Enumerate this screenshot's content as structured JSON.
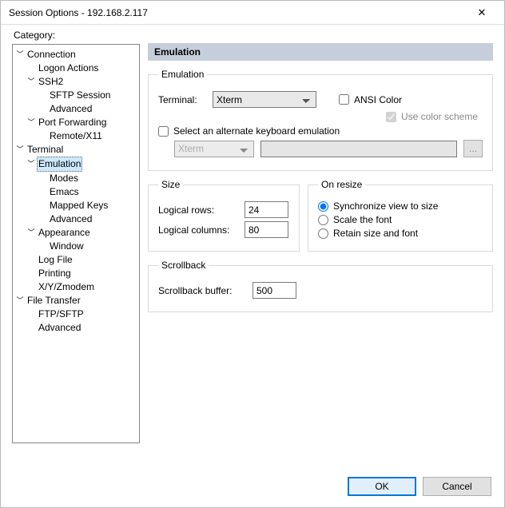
{
  "window": {
    "title": "Session Options - 192.168.2.117"
  },
  "category_label": "Category:",
  "tree": {
    "connection": "Connection",
    "logon_actions": "Logon Actions",
    "ssh2": "SSH2",
    "sftp_session": "SFTP Session",
    "ssh2_advanced": "Advanced",
    "port_forwarding": "Port Forwarding",
    "remote_x11": "Remote/X11",
    "terminal": "Terminal",
    "emulation": "Emulation",
    "modes": "Modes",
    "emacs": "Emacs",
    "mapped_keys": "Mapped Keys",
    "emu_advanced": "Advanced",
    "appearance": "Appearance",
    "window": "Window",
    "log_file": "Log File",
    "printing": "Printing",
    "xyz_zmodem": "X/Y/Zmodem",
    "file_transfer": "File Transfer",
    "ftp_sftp": "FTP/SFTP",
    "ft_advanced": "Advanced"
  },
  "panel": {
    "header": "Emulation",
    "emulation": {
      "legend": "Emulation",
      "terminal_label": "Terminal:",
      "terminal_value": "Xterm",
      "ansi_color_label": "ANSI Color",
      "use_color_scheme_label": "Use color scheme",
      "alt_kbd_label": "Select an alternate keyboard emulation",
      "alt_kbd_value": "Xterm",
      "ellipsis": "..."
    },
    "size": {
      "legend": "Size",
      "rows_label": "Logical rows:",
      "rows_value": "24",
      "cols_label": "Logical columns:",
      "cols_value": "80"
    },
    "on_resize": {
      "legend": "On resize",
      "sync_label": "Synchronize view to size",
      "scale_label": "Scale the font",
      "retain_label": "Retain size and font"
    },
    "scrollback": {
      "legend": "Scrollback",
      "buffer_label": "Scrollback buffer:",
      "buffer_value": "500"
    }
  },
  "buttons": {
    "ok": "OK",
    "cancel": "Cancel"
  }
}
